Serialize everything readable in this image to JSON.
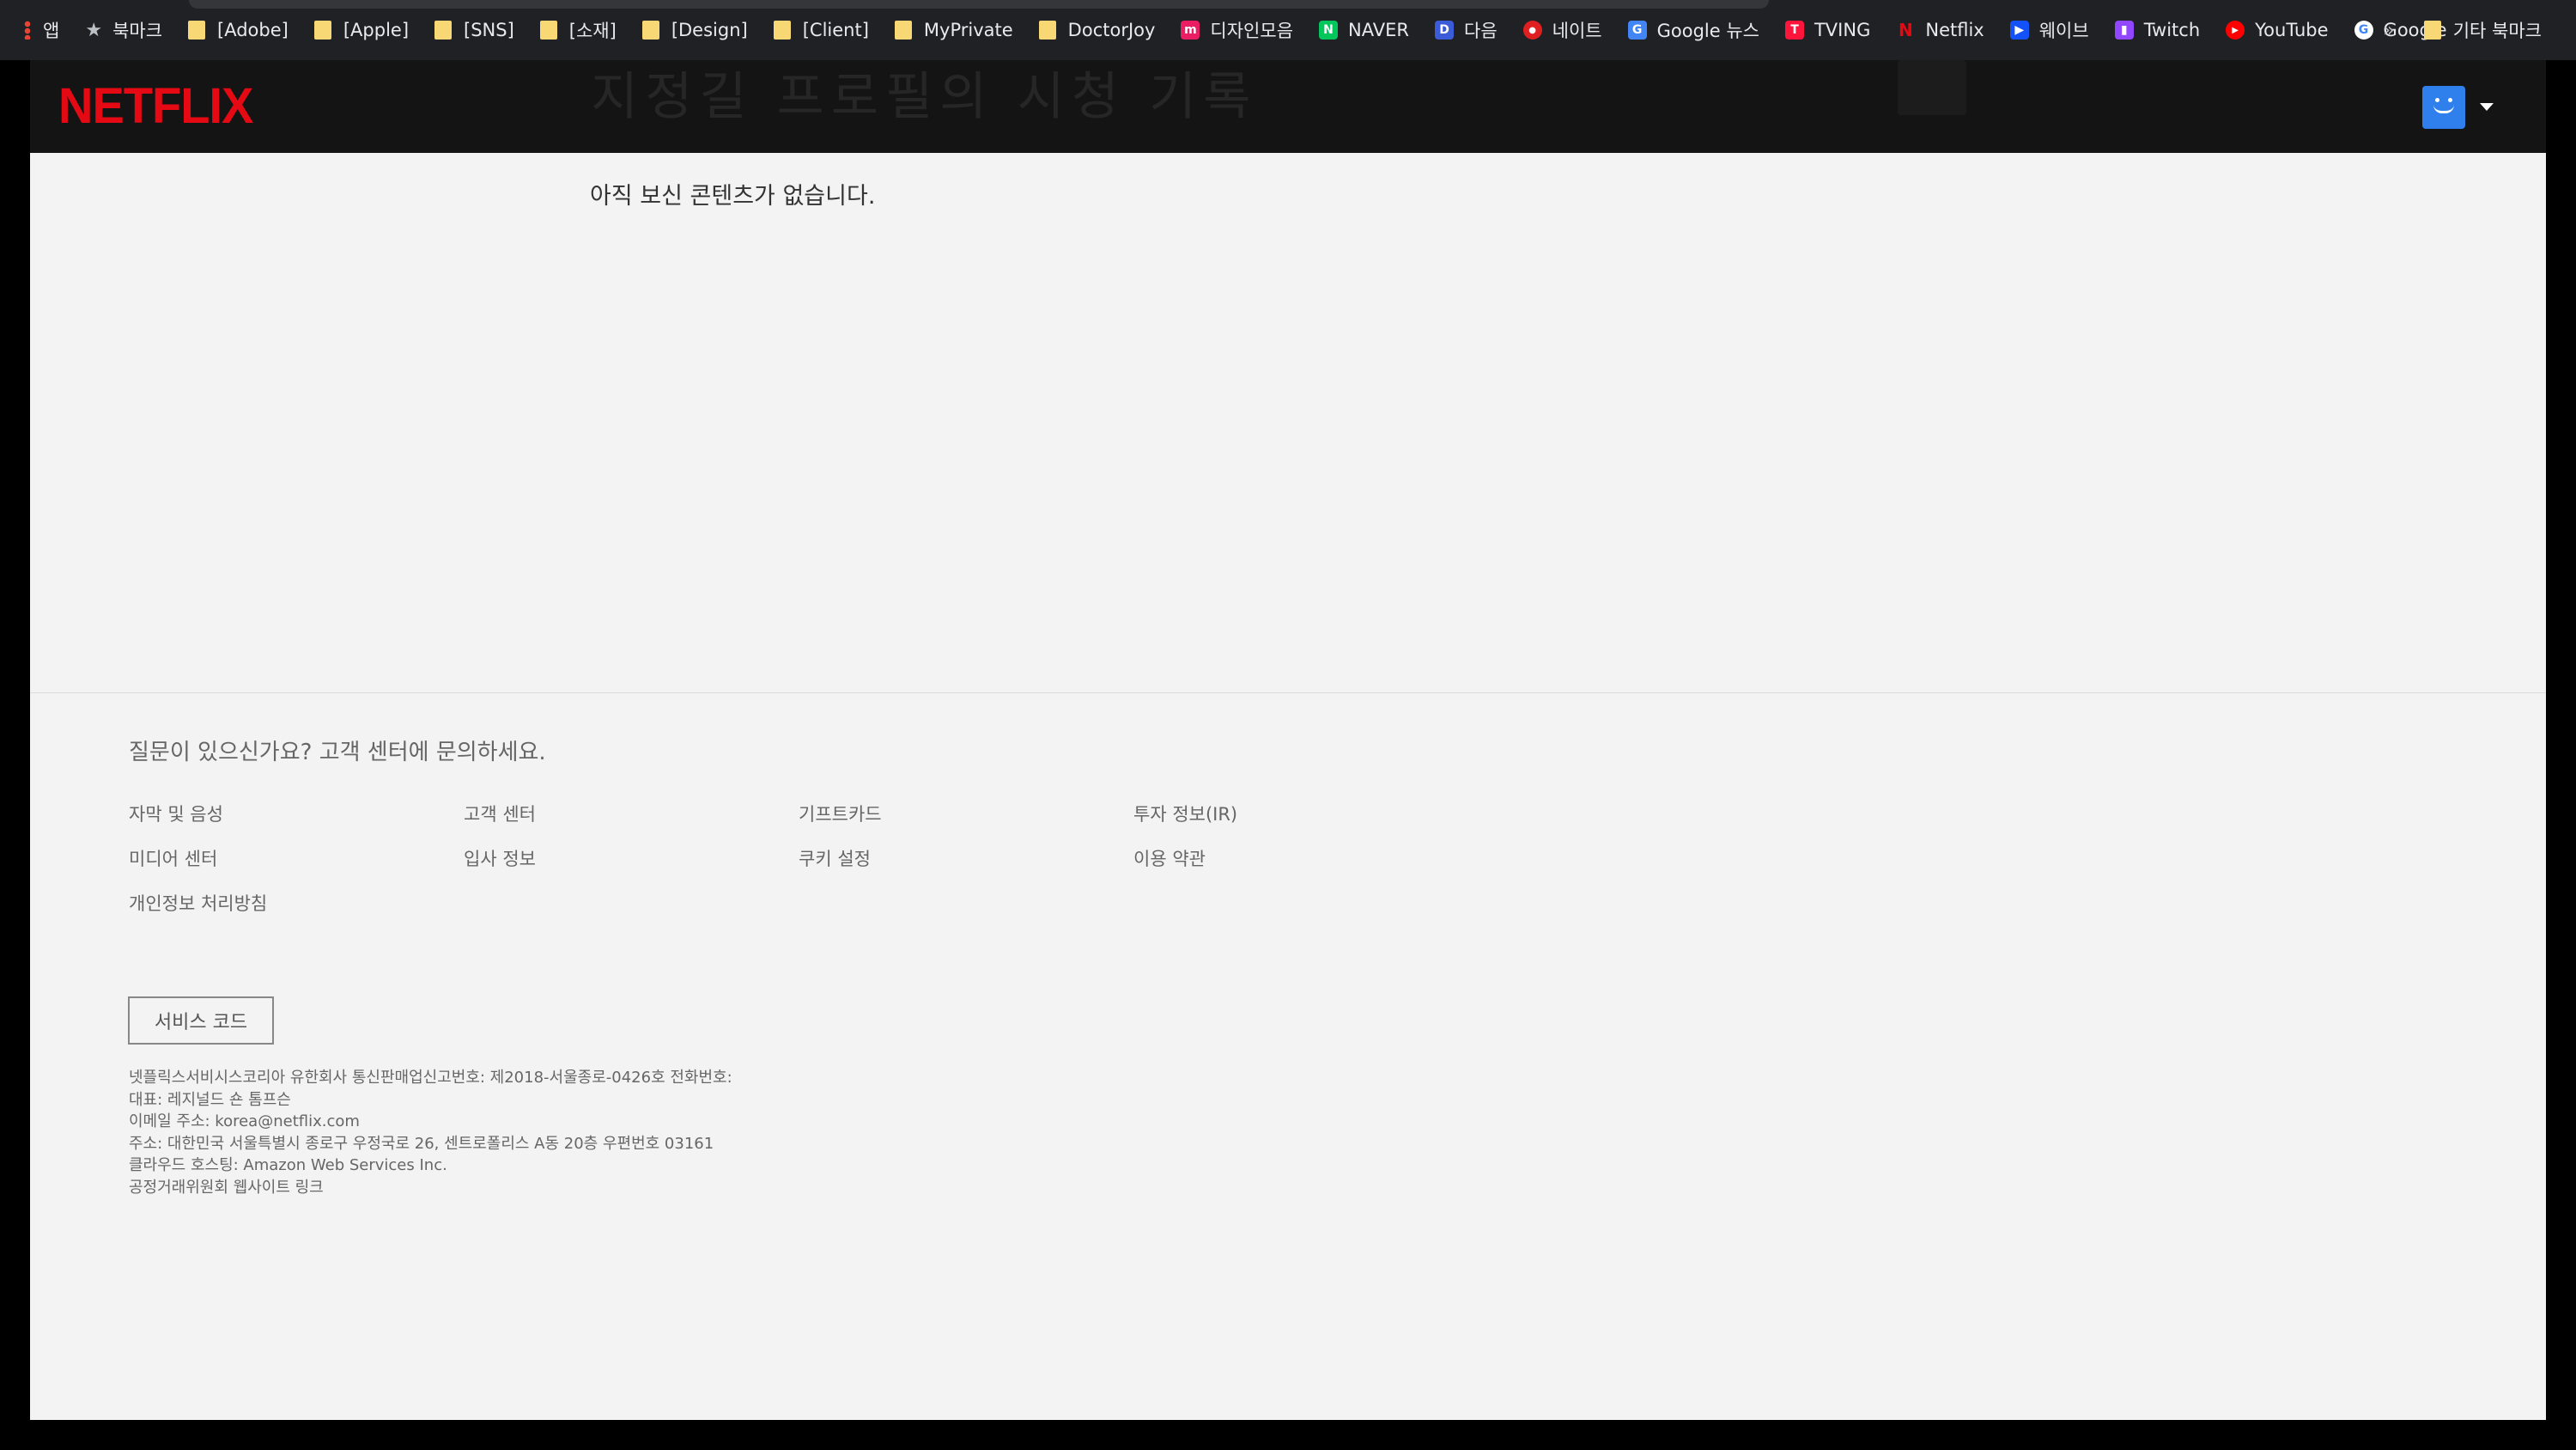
{
  "browser": {
    "bookmarks": [
      {
        "label": "앱",
        "icon": "apps-grid-icon"
      },
      {
        "label": "북마크",
        "icon": "star-icon"
      },
      {
        "label": "[Adobe]",
        "icon": "folder-icon"
      },
      {
        "label": "[Apple]",
        "icon": "folder-icon"
      },
      {
        "label": "[SNS]",
        "icon": "folder-icon"
      },
      {
        "label": "[소재]",
        "icon": "folder-icon"
      },
      {
        "label": "[Design]",
        "icon": "folder-icon"
      },
      {
        "label": "[Client]",
        "icon": "folder-icon"
      },
      {
        "label": "MyPrivate",
        "icon": "folder-icon"
      },
      {
        "label": "DoctorJoy",
        "icon": "folder-icon"
      },
      {
        "label": "디자인모음",
        "icon": "site-icon",
        "color": "#e91e63",
        "glyph": "m"
      },
      {
        "label": "NAVER",
        "icon": "naver-icon",
        "color": "#03c75a",
        "glyph": "N"
      },
      {
        "label": "다음",
        "icon": "daum-icon",
        "color": "#3c5bd9",
        "glyph": "D"
      },
      {
        "label": "네이트",
        "icon": "nate-icon",
        "color": "#e02020",
        "glyph": "●"
      },
      {
        "label": "Google 뉴스",
        "icon": "google-news-icon",
        "color": "#4285f4",
        "glyph": "G"
      },
      {
        "label": "TVING",
        "icon": "tving-icon",
        "color": "#ff153c",
        "glyph": "T"
      },
      {
        "label": "Netflix",
        "icon": "netflix-icon",
        "color": "#e50914",
        "glyph": "N"
      },
      {
        "label": "웨이브",
        "icon": "wavve-icon",
        "color": "#1351f9",
        "glyph": "▶"
      },
      {
        "label": "Twitch",
        "icon": "twitch-icon",
        "color": "#9146ff",
        "glyph": "▮"
      },
      {
        "label": "YouTube",
        "icon": "youtube-icon",
        "color": "#ff0000",
        "glyph": "▶"
      },
      {
        "label": "Google",
        "icon": "google-icon",
        "color": "#ffffff",
        "glyph": "G"
      }
    ],
    "overflow_label": "»",
    "other_bookmarks": "기타 북마크"
  },
  "header": {
    "logo": "NETFLIX",
    "ghost_title": "지정길 프로필의 시청 기록"
  },
  "main": {
    "empty_message": "아직 보신 콘텐츠가 없습니다."
  },
  "footer": {
    "question": "질문이 있으신가요? 고객 센터에 문의하세요.",
    "links": [
      "자막 및 음성",
      "고객 센터",
      "기프트카드",
      "투자 정보(IR)",
      "미디어 센터",
      "입사 정보",
      "쿠키 설정",
      "이용 약관",
      "개인정보 처리방침"
    ],
    "service_code": "서비스 코드",
    "legal": [
      "넷플릭스서비시스코리아 유한회사 통신판매업신고번호: 제2018-서울종로-0426호 전화번호:",
      "대표: 레지널드 숀 톰프슨",
      "이메일 주소: korea@netflix.com",
      "주소: 대한민국 서울특별시 종로구 우정국로 26, 센트로폴리스 A동 20층 우편번호 03161",
      "클라우드 호스팅: Amazon Web Services Inc.",
      "공정거래위원회 웹사이트 링크"
    ]
  }
}
